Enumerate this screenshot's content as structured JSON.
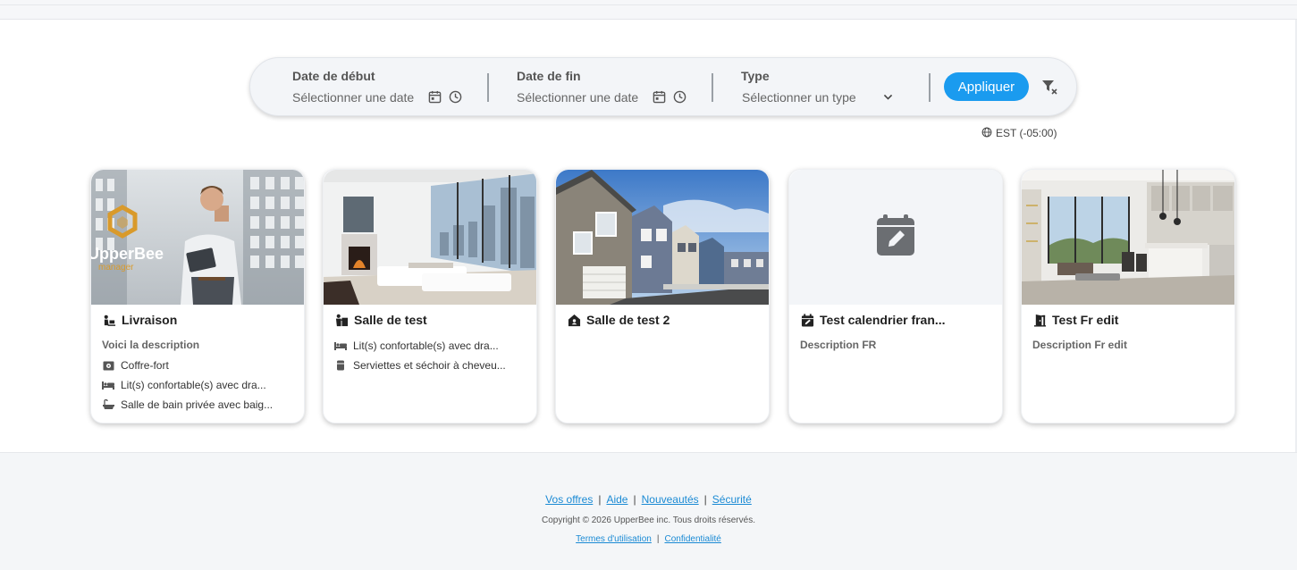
{
  "filters": {
    "start": {
      "label": "Date de début",
      "placeholder": "Sélectionner une date"
    },
    "end": {
      "label": "Date de fin",
      "placeholder": "Sélectionner une date"
    },
    "type": {
      "label": "Type",
      "placeholder": "Sélectionner un type"
    },
    "apply_label": "Appliquer",
    "clear_icon": "filter-remove-icon"
  },
  "timezone": {
    "label": "EST (-05:00)",
    "icon": "globe-icon"
  },
  "logo": {
    "brand": "UpperBee",
    "sub": "manager"
  },
  "cards": [
    {
      "title": "Livraison",
      "icon": "dolly-icon",
      "description": "Voici la description",
      "amenities": [
        {
          "icon": "safe-icon",
          "label": "Coffre-fort"
        },
        {
          "icon": "bed-icon",
          "label": "Lit(s) confortable(s) avec dra..."
        },
        {
          "icon": "bath-icon",
          "label": "Salle de bain privée avec baig..."
        }
      ]
    },
    {
      "title": "Salle de test",
      "icon": "person-chalkboard-icon",
      "description": "",
      "amenities": [
        {
          "icon": "bed-icon",
          "label": "Lit(s) confortable(s) avec dra..."
        },
        {
          "icon": "towel-icon",
          "label": "Serviettes et séchoir à cheveu..."
        }
      ]
    },
    {
      "title": "Salle de test 2",
      "icon": "house-user-icon",
      "description": "",
      "amenities": []
    },
    {
      "title": "Test calendrier fran...",
      "icon": "calendar-edit-icon",
      "description": "Description FR",
      "amenities": []
    },
    {
      "title": "Test Fr edit",
      "icon": "door-open-icon",
      "description": "Description Fr edit",
      "amenities": []
    }
  ],
  "footer": {
    "links": [
      "Vos offres",
      "Aide",
      "Nouveautés",
      "Sécurité"
    ],
    "copyright": "Copyright © 2026 UpperBee inc. Tous droits réservés.",
    "legal_links": [
      "Termes d'utilisation",
      "Confidentialité"
    ]
  },
  "colors": {
    "accent": "#1a9bef",
    "link": "#1a8ad4",
    "logo_gold": "#d99a2b"
  }
}
